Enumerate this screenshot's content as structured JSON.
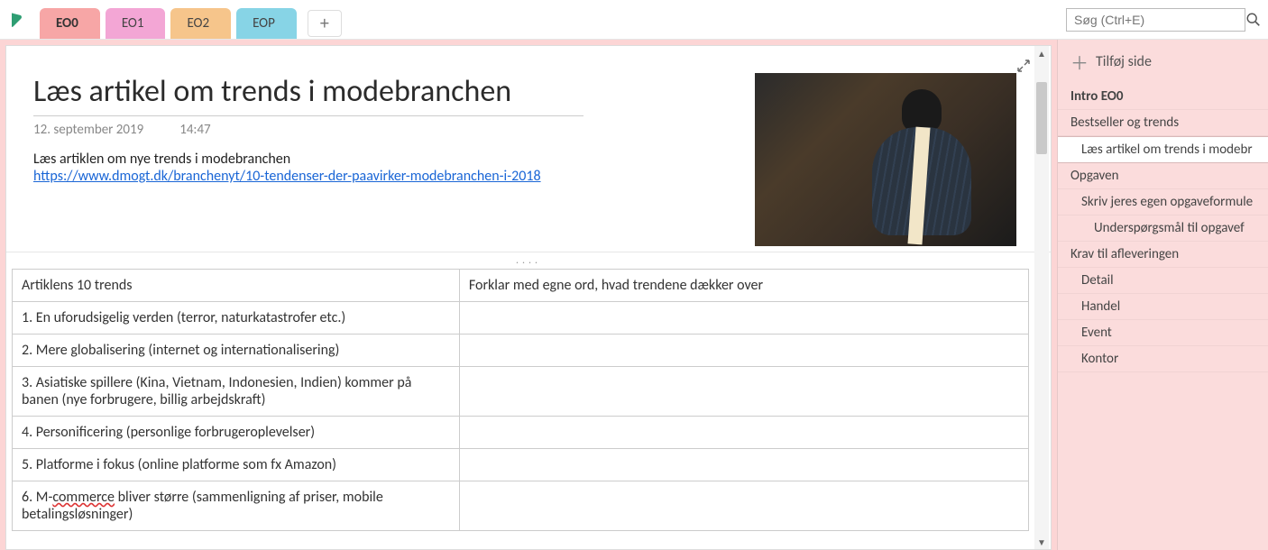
{
  "search": {
    "placeholder": "Søg (Ctrl+E)"
  },
  "tabs": {
    "eo0": "EO0",
    "eo1": "EO1",
    "eo2": "EO2",
    "eop": "EOP",
    "add": "+"
  },
  "page": {
    "title": "Læs artikel om trends i modebranchen",
    "date": "12. september 2019",
    "time": "14:47",
    "intro": "Læs artiklen om nye trends i modebranchen",
    "link_text": "https://www.dmogt.dk/branchenyt/10-tendenser-der-paavirker-modebranchen-i-2018"
  },
  "table": {
    "col1": "Artiklens 10 trends",
    "col2": "Forklar med egne ord, hvad trendene dækker over",
    "rows": [
      "1. En uforudsigelig verden (terror, naturkatastrofer etc.)",
      "2. Mere globalisering (internet og internationalisering)",
      "3. Asiatiske spillere (Kina, Vietnam, Indonesien, Indien) kommer på banen (nye forbrugere, billig arbejdskraft)",
      "4. Personificering (personlige forbrugeroplevelser)",
      "5. Platforme i fokus (online platforme som fx Amazon)",
      "6. M-commerce bliver større (sammenligning af priser, mobile betalingsløsninger)"
    ]
  },
  "sidebar": {
    "add_page": "Tilføj side",
    "items": [
      {
        "label": "Intro EO0",
        "level": 0,
        "bold": true
      },
      {
        "label": "Bestseller og trends",
        "level": 0
      },
      {
        "label": "Læs artikel om trends i modebr",
        "level": 1,
        "selected": true
      },
      {
        "label": "Opgaven",
        "level": 0
      },
      {
        "label": "Skriv jeres egen opgaveformule",
        "level": 1
      },
      {
        "label": "Underspørgsmål til opgavef",
        "level": 2
      },
      {
        "label": "Krav til afleveringen",
        "level": 0
      },
      {
        "label": "Detail",
        "level": 1
      },
      {
        "label": "Handel",
        "level": 1
      },
      {
        "label": "Event",
        "level": 1
      },
      {
        "label": "Kontor",
        "level": 1
      }
    ]
  },
  "splitter": "...."
}
